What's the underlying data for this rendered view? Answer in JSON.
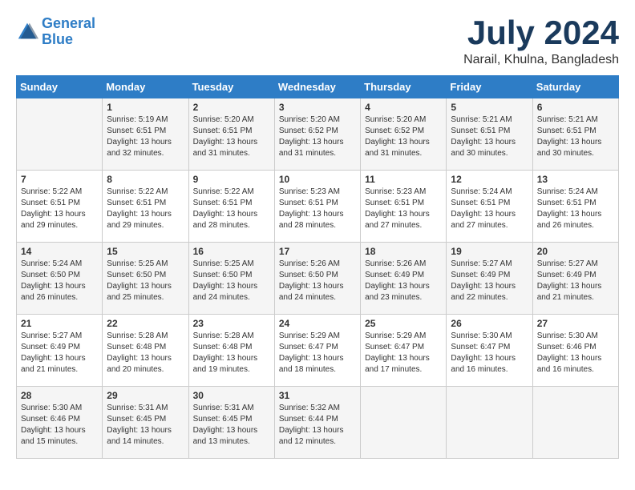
{
  "header": {
    "logo_line1": "General",
    "logo_line2": "Blue",
    "month": "July 2024",
    "location": "Narail, Khulna, Bangladesh"
  },
  "calendar": {
    "days_of_week": [
      "Sunday",
      "Monday",
      "Tuesday",
      "Wednesday",
      "Thursday",
      "Friday",
      "Saturday"
    ],
    "weeks": [
      [
        {
          "day": "",
          "info": ""
        },
        {
          "day": "1",
          "info": "Sunrise: 5:19 AM\nSunset: 6:51 PM\nDaylight: 13 hours\nand 32 minutes."
        },
        {
          "day": "2",
          "info": "Sunrise: 5:20 AM\nSunset: 6:51 PM\nDaylight: 13 hours\nand 31 minutes."
        },
        {
          "day": "3",
          "info": "Sunrise: 5:20 AM\nSunset: 6:52 PM\nDaylight: 13 hours\nand 31 minutes."
        },
        {
          "day": "4",
          "info": "Sunrise: 5:20 AM\nSunset: 6:52 PM\nDaylight: 13 hours\nand 31 minutes."
        },
        {
          "day": "5",
          "info": "Sunrise: 5:21 AM\nSunset: 6:51 PM\nDaylight: 13 hours\nand 30 minutes."
        },
        {
          "day": "6",
          "info": "Sunrise: 5:21 AM\nSunset: 6:51 PM\nDaylight: 13 hours\nand 30 minutes."
        }
      ],
      [
        {
          "day": "7",
          "info": "Sunrise: 5:22 AM\nSunset: 6:51 PM\nDaylight: 13 hours\nand 29 minutes."
        },
        {
          "day": "8",
          "info": "Sunrise: 5:22 AM\nSunset: 6:51 PM\nDaylight: 13 hours\nand 29 minutes."
        },
        {
          "day": "9",
          "info": "Sunrise: 5:22 AM\nSunset: 6:51 PM\nDaylight: 13 hours\nand 28 minutes."
        },
        {
          "day": "10",
          "info": "Sunrise: 5:23 AM\nSunset: 6:51 PM\nDaylight: 13 hours\nand 28 minutes."
        },
        {
          "day": "11",
          "info": "Sunrise: 5:23 AM\nSunset: 6:51 PM\nDaylight: 13 hours\nand 27 minutes."
        },
        {
          "day": "12",
          "info": "Sunrise: 5:24 AM\nSunset: 6:51 PM\nDaylight: 13 hours\nand 27 minutes."
        },
        {
          "day": "13",
          "info": "Sunrise: 5:24 AM\nSunset: 6:51 PM\nDaylight: 13 hours\nand 26 minutes."
        }
      ],
      [
        {
          "day": "14",
          "info": "Sunrise: 5:24 AM\nSunset: 6:50 PM\nDaylight: 13 hours\nand 26 minutes."
        },
        {
          "day": "15",
          "info": "Sunrise: 5:25 AM\nSunset: 6:50 PM\nDaylight: 13 hours\nand 25 minutes."
        },
        {
          "day": "16",
          "info": "Sunrise: 5:25 AM\nSunset: 6:50 PM\nDaylight: 13 hours\nand 24 minutes."
        },
        {
          "day": "17",
          "info": "Sunrise: 5:26 AM\nSunset: 6:50 PM\nDaylight: 13 hours\nand 24 minutes."
        },
        {
          "day": "18",
          "info": "Sunrise: 5:26 AM\nSunset: 6:49 PM\nDaylight: 13 hours\nand 23 minutes."
        },
        {
          "day": "19",
          "info": "Sunrise: 5:27 AM\nSunset: 6:49 PM\nDaylight: 13 hours\nand 22 minutes."
        },
        {
          "day": "20",
          "info": "Sunrise: 5:27 AM\nSunset: 6:49 PM\nDaylight: 13 hours\nand 21 minutes."
        }
      ],
      [
        {
          "day": "21",
          "info": "Sunrise: 5:27 AM\nSunset: 6:49 PM\nDaylight: 13 hours\nand 21 minutes."
        },
        {
          "day": "22",
          "info": "Sunrise: 5:28 AM\nSunset: 6:48 PM\nDaylight: 13 hours\nand 20 minutes."
        },
        {
          "day": "23",
          "info": "Sunrise: 5:28 AM\nSunset: 6:48 PM\nDaylight: 13 hours\nand 19 minutes."
        },
        {
          "day": "24",
          "info": "Sunrise: 5:29 AM\nSunset: 6:47 PM\nDaylight: 13 hours\nand 18 minutes."
        },
        {
          "day": "25",
          "info": "Sunrise: 5:29 AM\nSunset: 6:47 PM\nDaylight: 13 hours\nand 17 minutes."
        },
        {
          "day": "26",
          "info": "Sunrise: 5:30 AM\nSunset: 6:47 PM\nDaylight: 13 hours\nand 16 minutes."
        },
        {
          "day": "27",
          "info": "Sunrise: 5:30 AM\nSunset: 6:46 PM\nDaylight: 13 hours\nand 16 minutes."
        }
      ],
      [
        {
          "day": "28",
          "info": "Sunrise: 5:30 AM\nSunset: 6:46 PM\nDaylight: 13 hours\nand 15 minutes."
        },
        {
          "day": "29",
          "info": "Sunrise: 5:31 AM\nSunset: 6:45 PM\nDaylight: 13 hours\nand 14 minutes."
        },
        {
          "day": "30",
          "info": "Sunrise: 5:31 AM\nSunset: 6:45 PM\nDaylight: 13 hours\nand 13 minutes."
        },
        {
          "day": "31",
          "info": "Sunrise: 5:32 AM\nSunset: 6:44 PM\nDaylight: 13 hours\nand 12 minutes."
        },
        {
          "day": "",
          "info": ""
        },
        {
          "day": "",
          "info": ""
        },
        {
          "day": "",
          "info": ""
        }
      ]
    ]
  }
}
